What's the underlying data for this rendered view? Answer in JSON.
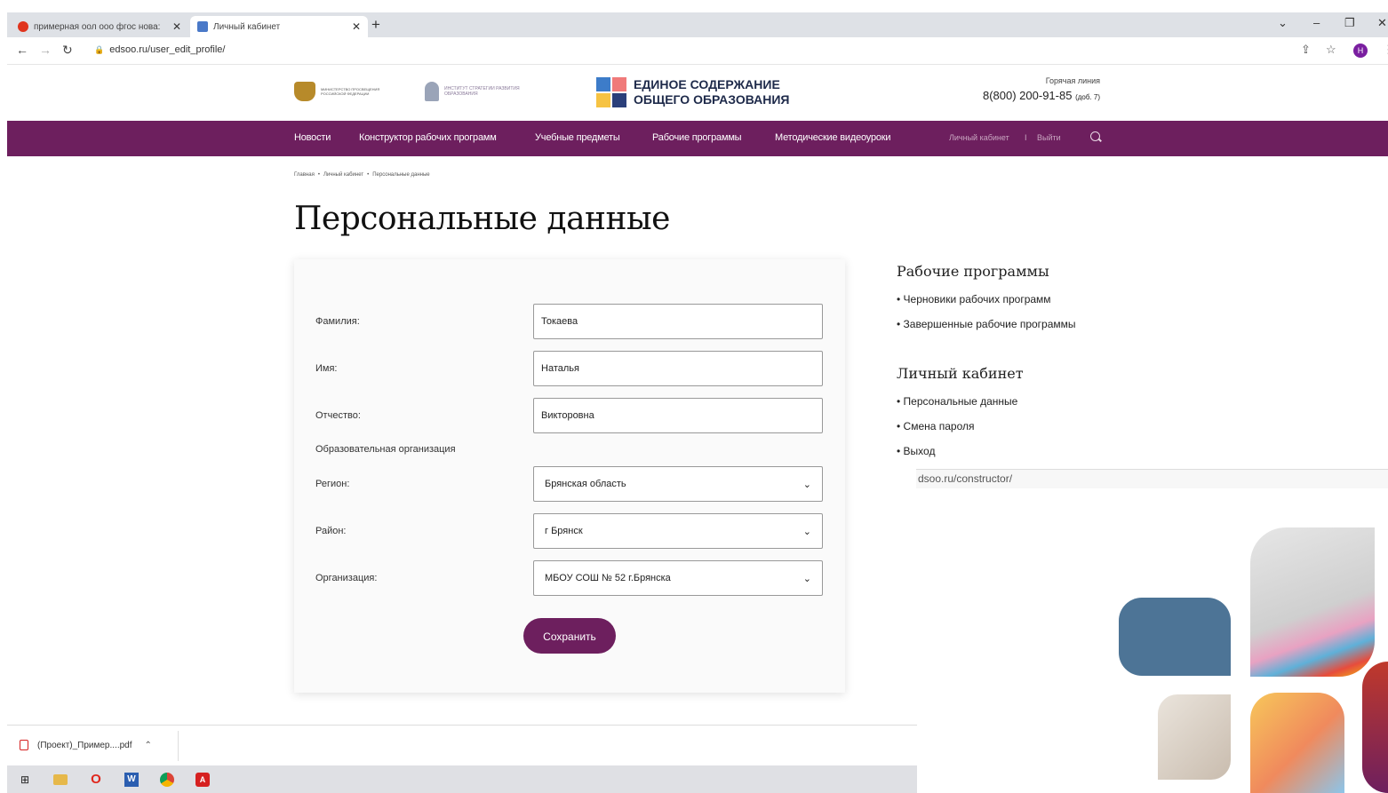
{
  "browser": {
    "tabs": [
      {
        "title": "примерная оол ооо фгос нова:",
        "active": false,
        "favicon_color": "#e0341d"
      },
      {
        "title": "Личный кабинет",
        "active": true,
        "favicon_color": "#4a79c8"
      }
    ],
    "url": "edsoo.ru/user_edit_profile/",
    "profile_initial": "Н"
  },
  "header": {
    "logo1_text": "МИНИСТЕРСТВО ПРОСВЕЩЕНИЯ РОССИЙСКОЙ ФЕДЕРАЦИИ",
    "logo2_text": "ИНСТИТУТ СТРАТЕГИИ РАЗВИТИЯ ОБРАЗОВАНИЯ",
    "brand_line1": "ЕДИНОЕ СОДЕРЖАНИЕ",
    "brand_line2": "ОБЩЕГО ОБРАЗОВАНИЯ",
    "hotline_label": "Горячая линия",
    "phone": "8(800) 200-91-85",
    "phone_ext": "(доб. 7)"
  },
  "nav": {
    "items": [
      "Новости",
      "Конструктор рабочих программ",
      "Учебные предметы",
      "Рабочие программы",
      "Методические видеоуроки"
    ],
    "account_label": "Личный кабинет",
    "separator": "I",
    "logout_label": "Выйти",
    "bg_color": "#6d1f5e"
  },
  "breadcrumb": [
    "Главная",
    "Личный кабинет",
    "Персональные данные"
  ],
  "page_title": "Персональные данные",
  "form": {
    "fields": [
      {
        "label": "Фамилия:",
        "value": "Токаева"
      },
      {
        "label": "Имя:",
        "value": "Наталья"
      },
      {
        "label": "Отчество:",
        "value": "Викторовна"
      }
    ],
    "section_label": "Образовательная организация",
    "selects": [
      {
        "label": "Регион:",
        "value": "Брянская область"
      },
      {
        "label": "Район:",
        "value": "г Брянск"
      },
      {
        "label": "Организация:",
        "value": "МБОУ СОШ № 52 г.Брянска"
      }
    ],
    "save_label": "Сохранить"
  },
  "sidebar": {
    "section1_title": "Рабочие программы",
    "section1_links": [
      "• Черновики рабочих программ",
      "• Завершенные рабочие программы"
    ],
    "section2_title": "Личный кабинет",
    "section2_links": [
      "• Персональные данные",
      "• Смена пароля",
      "• Выход"
    ]
  },
  "status_url": "dsoo.ru/constructor/",
  "download": {
    "filename": "(Проект)_Пример....pdf"
  }
}
